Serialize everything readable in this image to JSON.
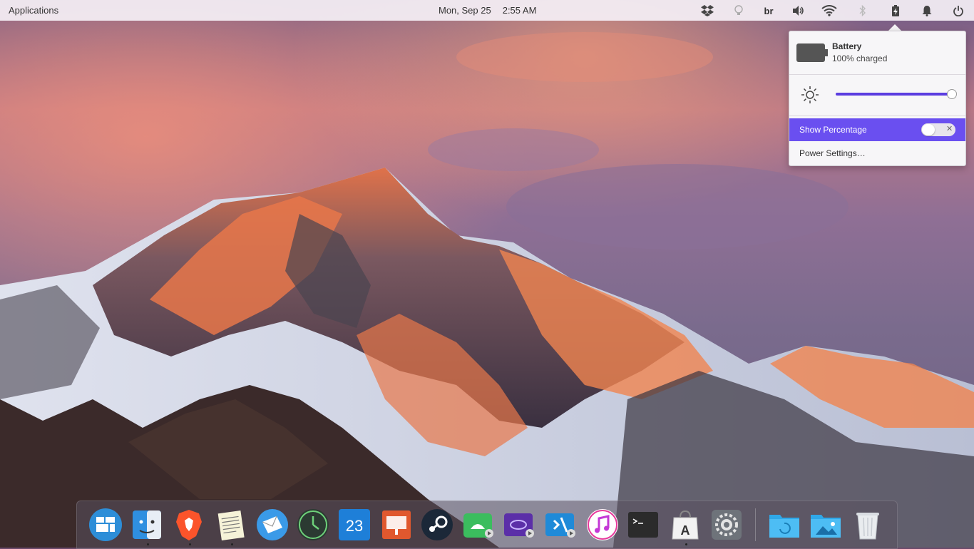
{
  "topbar": {
    "applications_label": "Applications",
    "date": "Mon, Sep 25",
    "time": "2:55 AM",
    "keyboard_layout": "br"
  },
  "tray_icons": [
    "dropbox-icon",
    "lightbulb-icon",
    "keyboard-layout",
    "volume-icon",
    "wifi-icon",
    "bluetooth-icon",
    "battery-icon",
    "notifications-icon",
    "power-icon"
  ],
  "battery_popover": {
    "title": "Battery",
    "status": "100% charged",
    "brightness_level": 1.0,
    "show_percentage_label": "Show Percentage",
    "show_percentage_enabled": false,
    "power_settings_label": "Power Settings…"
  },
  "dock": {
    "items": [
      "multitasking-view",
      "files",
      "brave",
      "notes",
      "mail",
      "clock",
      "calendar",
      "presentation",
      "steam",
      "android-studio",
      "screencast",
      "visual-studio-code",
      "music",
      "terminal",
      "app-center",
      "system-settings",
      "downloads-folder",
      "pictures-folder",
      "trash"
    ],
    "calendar_day": "23",
    "running": [
      "files",
      "brave",
      "notes",
      "app-center"
    ]
  },
  "colors": {
    "accent": "#6a4ff0",
    "panel": "#f5f0f6"
  }
}
